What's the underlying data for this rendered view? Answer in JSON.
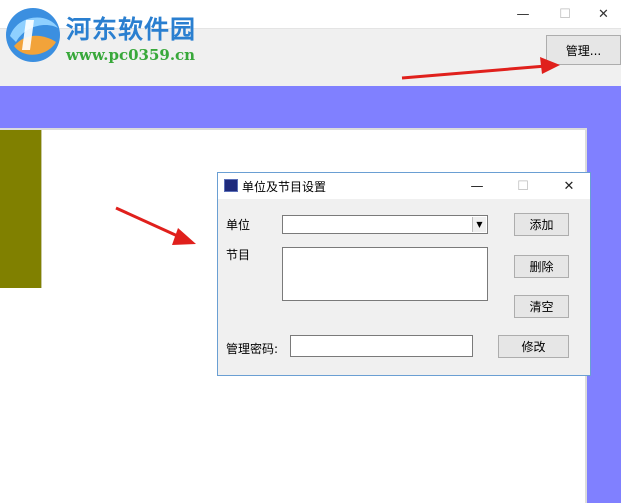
{
  "window": {
    "controls": {
      "minimize": "—",
      "maximize": "☐",
      "close": "✕"
    }
  },
  "watermark": {
    "name": "河东软件园",
    "url": "www.pc0359.cn"
  },
  "toolbar": {
    "manage_label": "管理..."
  },
  "dialog": {
    "title": "单位及节目设置",
    "controls": {
      "minimize": "—",
      "maximize": "☐",
      "close": "✕"
    },
    "unit_label": "单位",
    "unit_value": "",
    "program_label": "节目",
    "password_label": "管理密码:",
    "password_value": "",
    "add_label": "添加",
    "delete_label": "删除",
    "clear_label": "清空",
    "modify_label": "修改"
  },
  "colors": {
    "purple_background": "#8080ff",
    "olive_panel": "#808000",
    "arrow": "#e0201c"
  }
}
